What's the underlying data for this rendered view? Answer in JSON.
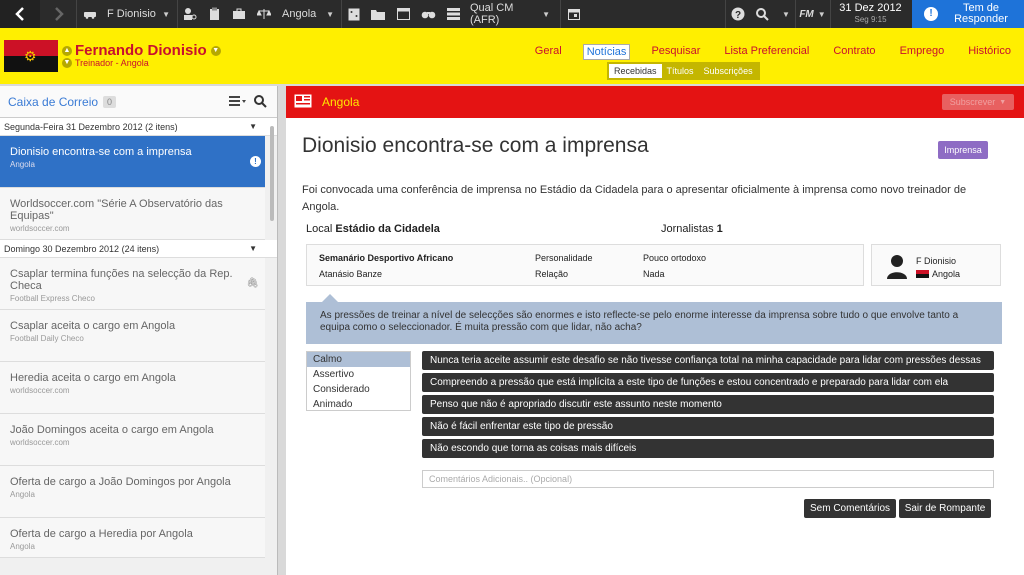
{
  "topbar": {
    "club": "F Dionisio",
    "country": "Angola",
    "competition": "Qual CM (AFR)",
    "fm_label": "FM",
    "date": "31 Dez 2012",
    "day_time": "Seg 9:15",
    "respond_label": "Tem de Responder"
  },
  "header": {
    "name": "Fernando Dionisio",
    "role": "Treinador - Angola",
    "nav": [
      "Geral",
      "Notícias",
      "Pesquisar",
      "Lista Preferencial",
      "Contrato",
      "Emprego",
      "Histórico"
    ],
    "subnav": [
      "Recebidas",
      "Títulos",
      "Subscrições"
    ]
  },
  "inbox": {
    "title": "Caixa de Correio",
    "count": "0",
    "day1": "Segunda-Feira 31 Dezembro 2012 (2 itens)",
    "day2": "Domingo 30 Dezembro 2012 (24 itens)",
    "messages": [
      {
        "title": "Dionisio encontra-se com a imprensa",
        "source": "Angola"
      },
      {
        "title": "Worldsoccer.com \"Série A Observatório das Equipas\"",
        "source": "worldsoccer.com"
      },
      {
        "title": "Csaplar termina funções na selecção da Rep. Checa",
        "source": "Football Express Checo"
      },
      {
        "title": "Csaplar aceita o cargo em Angola",
        "source": "Football Daily Checo"
      },
      {
        "title": "Heredia aceita o cargo em Angola",
        "source": "worldsoccer.com"
      },
      {
        "title": "João Domingos aceita o cargo em Angola",
        "source": "worldsoccer.com"
      },
      {
        "title": "Oferta de cargo a João Domingos por Angola",
        "source": "Angola"
      },
      {
        "title": "Oferta de cargo a Heredia por Angola",
        "source": "Angola"
      }
    ]
  },
  "detail": {
    "bar_title": "Angola",
    "subscribe_label": "Subscrever",
    "title": "Dionisio encontra-se com a imprensa",
    "tag": "Imprensa",
    "body": "Foi convocada uma conferência de imprensa no Estádio da Cidadela para o apresentar oficialmente à imprensa como novo treinador de Angola.",
    "local_label": "Local",
    "local_value": "Estádio da Cidadela",
    "jorn_label": "Jornalistas",
    "jorn_value": "1",
    "journal_name": "Semanário Desportivo Africano",
    "journalist": "Atanásio Banze",
    "personality_label": "Personalidade",
    "personality_value": "Pouco ortodoxo",
    "relation_label": "Relação",
    "relation_value": "Nada",
    "person_name": "F Dionisio",
    "person_country": "Angola",
    "question": "As pressões de treinar a nível de selecções são enormes e isto reflecte-se pelo enorme interesse da imprensa sobre tudo o que envolve tanto a equipa como o seleccionador. É muita pressão com que lidar, não acha?",
    "tones": [
      "Calmo",
      "Assertivo",
      "Considerado",
      "Animado"
    ],
    "replies": [
      "Nunca teria aceite assumir este desafio se não tivesse confiança total na minha capacidade para lidar com pressões dessas",
      "Compreendo a pressão que está implícita a este tipo de funções e estou concentrado e preparado para lidar com ela",
      "Penso que não é apropriado discutir este assunto neste momento",
      "Não é fácil enfrentar este tipo de pressão",
      "Não escondo que torna as coisas mais difíceis"
    ],
    "comment_placeholder": "Comentários Adicionais.. (Opcional)",
    "no_comment_label": "Sem Comentários",
    "storm_out_label": "Sair de Rompante"
  }
}
